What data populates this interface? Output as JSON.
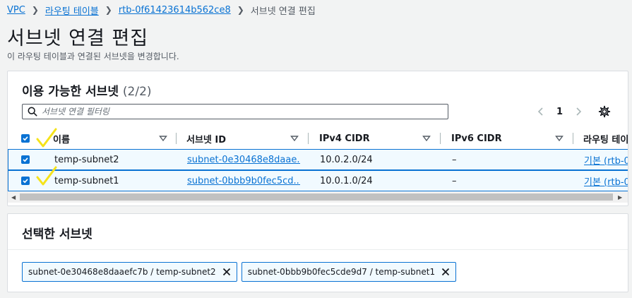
{
  "breadcrumb": {
    "items": [
      "VPC",
      "라우팅 테이블",
      "rtb-0f61423614b562ce8"
    ],
    "current": "서브넷 연결 편집"
  },
  "page": {
    "title": "서브넷 연결 편집",
    "description": "이 라우팅 테이블과 연결된 서브넷을 변경합니다."
  },
  "available_subnets": {
    "heading": "이용 가능한 서브넷",
    "count": "(2/2)",
    "filter_placeholder": "서브넷 연결 필터링",
    "page_number": "1",
    "columns": [
      "이름",
      "서브넷 ID",
      "IPv4 CIDR",
      "IPv6 CIDR",
      "라우팅 테이"
    ],
    "rows": [
      {
        "name": "temp-subnet2",
        "subnet_id": "subnet-0e30468e8daae...",
        "ipv4": "10.0.2.0/24",
        "ipv6": "–",
        "route": "기본 (rtb-0"
      },
      {
        "name": "temp-subnet1",
        "subnet_id": "subnet-0bbb9b0fec5cd...",
        "ipv4": "10.0.1.0/24",
        "ipv6": "–",
        "route": "기본 (rtb-0"
      }
    ]
  },
  "selected_subnets": {
    "heading": "선택한 서브넷",
    "tokens": [
      "subnet-0e30468e8daaefc7b / temp-subnet2",
      "subnet-0bbb9b0fec5cde9d7 / temp-subnet1"
    ]
  },
  "colors": {
    "accent": "#0972d3",
    "annotation_tick": "#f5e31a",
    "selected_row_bg": "#f1faff"
  }
}
